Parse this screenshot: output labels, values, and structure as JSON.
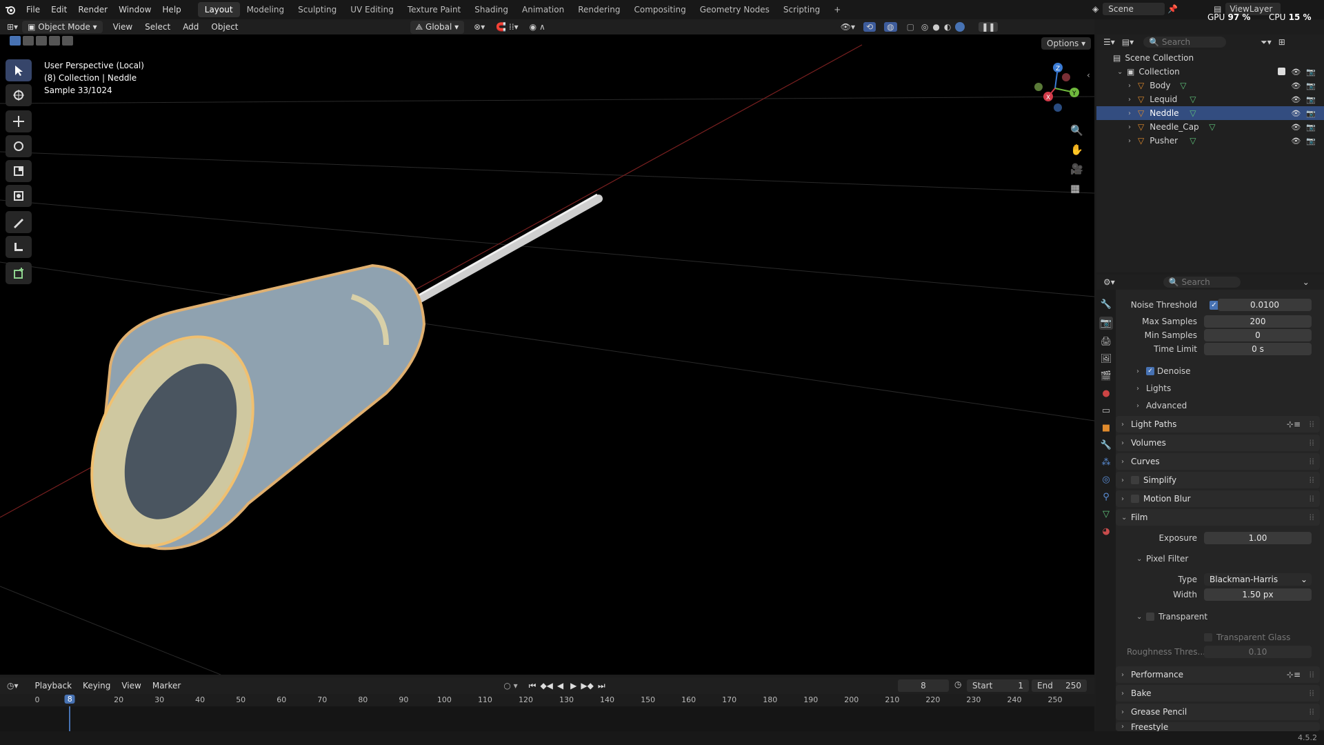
{
  "topbar": {
    "menu": [
      "File",
      "Edit",
      "Render",
      "Window",
      "Help"
    ],
    "workspaces": [
      "Layout",
      "Modeling",
      "Sculpting",
      "UV Editing",
      "Texture Paint",
      "Shading",
      "Animation",
      "Rendering",
      "Compositing",
      "Geometry Nodes",
      "Scripting"
    ],
    "active_workspace": "Layout",
    "add_tab": "+",
    "scene": "Scene",
    "view_layer": "ViewLayer",
    "gpu_label": "GPU",
    "gpu_value": "97 %",
    "cpu_label": "CPU",
    "cpu_value": "15 %"
  },
  "viewport_header": {
    "mode": "Object Mode",
    "menus": [
      "View",
      "Select",
      "Add",
      "Object"
    ],
    "orientation": "Global",
    "options": "Options"
  },
  "viewport": {
    "perspective": "User Perspective (Local)",
    "collection_info": "(8) Collection | Neddle",
    "sample": "Sample 33/1024"
  },
  "outliner": {
    "search_placeholder": "Search",
    "scene_collection": "Scene Collection",
    "collection": "Collection",
    "objects": [
      "Body",
      "Lequid",
      "Neddle",
      "Needle_Cap",
      "Pusher"
    ],
    "selected": "Neddle"
  },
  "properties": {
    "search_placeholder": "Search",
    "noise_threshold_label": "Noise Threshold",
    "noise_threshold": "0.0100",
    "max_samples_label": "Max Samples",
    "max_samples": "200",
    "min_samples_label": "Min Samples",
    "min_samples": "0",
    "time_limit_label": "Time Limit",
    "time_limit": "0 s",
    "denoise": "Denoise",
    "lights": "Lights",
    "advanced": "Advanced",
    "light_paths": "Light Paths",
    "volumes": "Volumes",
    "curves": "Curves",
    "simplify": "Simplify",
    "motion_blur": "Motion Blur",
    "film": "Film",
    "exposure_label": "Exposure",
    "exposure": "1.00",
    "pixel_filter": "Pixel Filter",
    "type_label": "Type",
    "type_value": "Blackman-Harris",
    "width_label": "Width",
    "width_value": "1.50 px",
    "transparent": "Transparent",
    "transparent_glass": "Transparent Glass",
    "roughness_label": "Roughness Thres...",
    "roughness_value": "0.10",
    "performance": "Performance",
    "bake": "Bake",
    "grease_pencil": "Grease Pencil",
    "freestyle": "Freestyle"
  },
  "timeline": {
    "menus": [
      "Playback",
      "Keying",
      "View",
      "Marker"
    ],
    "current_frame": "8",
    "start_label": "Start",
    "start": "1",
    "end_label": "End",
    "end": "250",
    "ruler": [
      "0",
      "20",
      "30",
      "40",
      "50",
      "60",
      "70",
      "80",
      "90",
      "100",
      "110",
      "120",
      "130",
      "140",
      "150",
      "160",
      "170",
      "180",
      "190",
      "200",
      "210",
      "220",
      "230",
      "240",
      "250"
    ],
    "playhead": "8"
  },
  "status": {
    "version": "4.5.2"
  }
}
